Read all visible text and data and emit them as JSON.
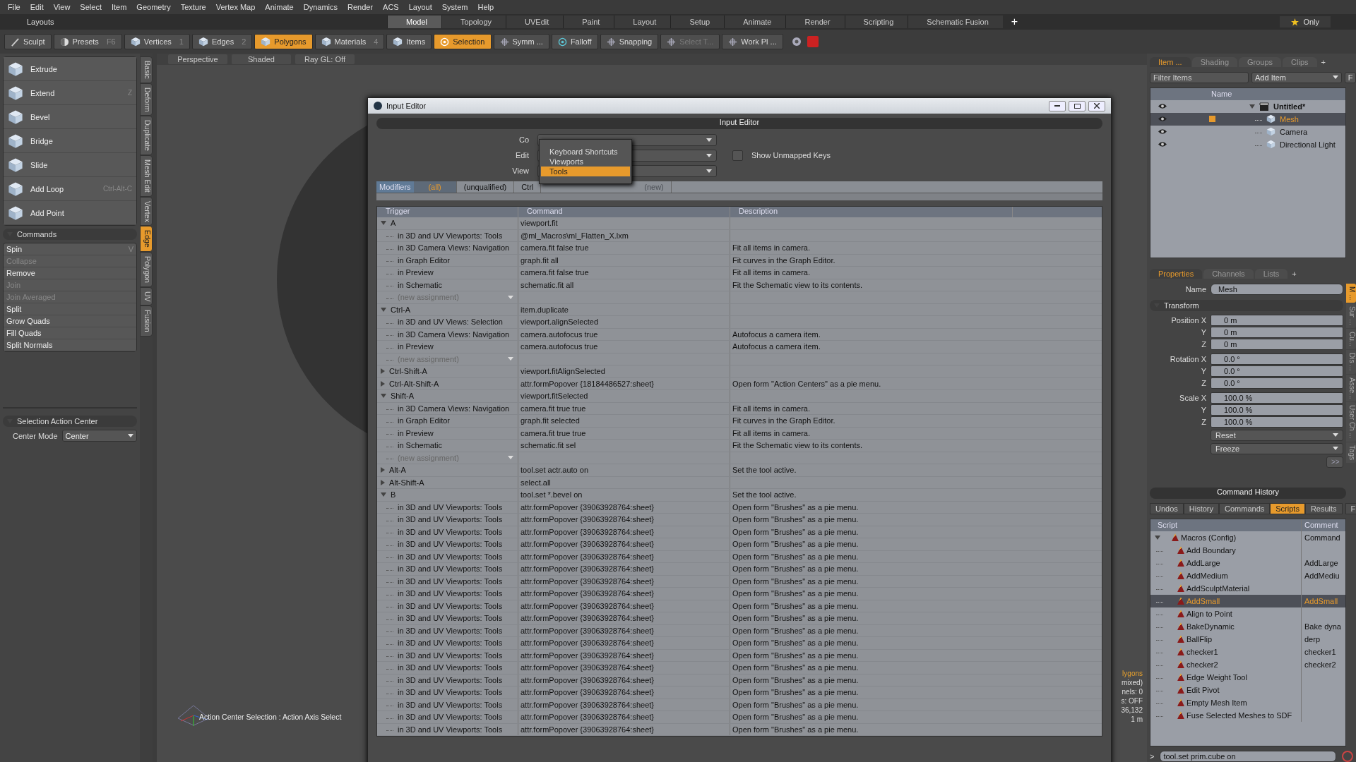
{
  "menu": [
    "File",
    "Edit",
    "View",
    "Select",
    "Item",
    "Geometry",
    "Texture",
    "Vertex Map",
    "Animate",
    "Dynamics",
    "Render",
    "ACS",
    "Layout",
    "System",
    "Help"
  ],
  "layouts": {
    "title": "Layouts",
    "add_label": "+",
    "only_label": "Only",
    "tabs": [
      {
        "label": "Model",
        "selected": true
      },
      {
        "label": "Topology",
        "selected": false
      },
      {
        "label": "UVEdit",
        "selected": false
      },
      {
        "label": "Paint",
        "selected": false
      },
      {
        "label": "Layout",
        "selected": false
      },
      {
        "label": "Setup",
        "selected": false
      },
      {
        "label": "Animate",
        "selected": false
      },
      {
        "label": "Render",
        "selected": false
      },
      {
        "label": "Scripting",
        "selected": false
      },
      {
        "label": "Schematic Fusion",
        "selected": false
      }
    ]
  },
  "toolbar": [
    {
      "label": "Sculpt",
      "selected": false,
      "disabled": false
    },
    {
      "label": "Presets",
      "key": "F6",
      "selected": false,
      "disabled": false
    },
    {
      "label": "Vertices",
      "key": "1",
      "selected": false,
      "disabled": false
    },
    {
      "label": "Edges",
      "key": "2",
      "selected": false,
      "disabled": false
    },
    {
      "label": "Polygons",
      "selected": true,
      "disabled": false
    },
    {
      "label": "Materials",
      "key": "4",
      "selected": false,
      "disabled": false
    },
    {
      "label": "Items",
      "selected": false,
      "disabled": false
    },
    {
      "label": "Selection",
      "selected": true,
      "disabled": false
    },
    {
      "label": "Symm ...",
      "selected": false,
      "disabled": false
    },
    {
      "label": "Falloff",
      "selected": false,
      "disabled": false
    },
    {
      "label": "Snapping",
      "selected": false,
      "disabled": false
    },
    {
      "label": "Select T...",
      "selected": false,
      "disabled": true
    },
    {
      "label": "Work Pl ...",
      "selected": false,
      "disabled": false
    }
  ],
  "left": {
    "tools": [
      {
        "label": "Extrude"
      },
      {
        "label": "Extend",
        "shortcut": "Z"
      },
      {
        "label": "Bevel"
      },
      {
        "label": "Bridge"
      },
      {
        "label": "Slide"
      },
      {
        "label": "Add Loop",
        "shortcut": "Ctrl-Alt-C"
      },
      {
        "label": "Add Point"
      }
    ],
    "commands_title": "Commands",
    "commands": [
      {
        "label": "Spin",
        "shortcut": "V",
        "disabled": false
      },
      {
        "label": "Collapse",
        "disabled": true
      },
      {
        "label": "Remove",
        "disabled": false
      },
      {
        "label": "Join",
        "disabled": true
      },
      {
        "label": "Join Averaged",
        "disabled": true
      },
      {
        "label": "Split",
        "disabled": false
      },
      {
        "label": "Grow Quads",
        "disabled": false
      },
      {
        "label": "Fill Quads",
        "disabled": false
      },
      {
        "label": "Split Normals",
        "disabled": false
      }
    ],
    "side_tabs": [
      {
        "label": "Basic",
        "selected": false
      },
      {
        "label": "Deform",
        "selected": false
      },
      {
        "label": "Duplicate",
        "selected": false
      },
      {
        "label": "Mesh Edit",
        "selected": false
      },
      {
        "label": "Vertex",
        "selected": false
      },
      {
        "label": "Edge",
        "selected": true
      },
      {
        "label": "Polygon",
        "selected": false
      },
      {
        "label": "UV",
        "selected": false
      },
      {
        "label": "Fusion",
        "selected": false
      }
    ],
    "action_center": {
      "title": "Selection Action Center",
      "field_label": "Center Mode",
      "value": "Center"
    }
  },
  "viewport": {
    "tabs": [
      "Perspective",
      "Shaded",
      "Ray GL: Off"
    ],
    "status": "Action Center Selection : Action Axis Select",
    "readout": [
      "lygons",
      "mixed)",
      "nels: 0",
      "s: OFF",
      "36,132",
      "1 m"
    ]
  },
  "dialog": {
    "title": "Input Editor",
    "header": "Input Editor",
    "fields": [
      {
        "label": "Co"
      },
      {
        "label": "Edit"
      },
      {
        "label": "View"
      }
    ],
    "show_unmapped": {
      "label": "Show Unmapped Keys",
      "checked": false
    },
    "popup": [
      {
        "label": "Keyboard Shortcuts",
        "selected": false
      },
      {
        "label": "Viewports",
        "selected": false
      },
      {
        "label": "Tools",
        "selected": true
      }
    ],
    "modifiers_label": "Modifiers",
    "modifiers": [
      {
        "label": "(all)",
        "selected": true,
        "disabled": false
      },
      {
        "label": "(unqualified)",
        "selected": false,
        "disabled": false
      },
      {
        "label": "Ctrl",
        "selected": false,
        "disabled": false
      },
      {
        "label": "(new)",
        "selected": false,
        "disabled": true
      }
    ],
    "columns": [
      "Trigger",
      "Command",
      "Description"
    ],
    "rows": [
      {
        "trigger": "A",
        "command": "viewport.fit",
        "expanded": true,
        "children": [
          {
            "kind": "assignment",
            "trigger": "in 3D and UV Viewports: Tools",
            "command": "@ml_Macros\\ml_Flatten_X.lxm"
          },
          {
            "kind": "assignment",
            "trigger": "in 3D Camera Views: Navigation",
            "command": "camera.fit false true",
            "description": "Fit all items in camera."
          },
          {
            "kind": "assignment",
            "trigger": "in Graph Editor",
            "command": "graph.fit all",
            "description": "Fit curves in the Graph Editor."
          },
          {
            "kind": "assignment",
            "trigger": "in Preview",
            "command": "camera.fit false true",
            "description": "Fit all items in camera."
          },
          {
            "kind": "assignment",
            "trigger": "in Schematic",
            "command": "schematic.fit all",
            "description": "Fit the Schematic view to its contents."
          },
          {
            "kind": "new",
            "trigger": "(new assignment)"
          }
        ]
      },
      {
        "trigger": "Ctrl-A",
        "command": "item.duplicate",
        "expanded": true,
        "children": [
          {
            "kind": "assignment",
            "trigger": "in 3D and UV Views: Selection",
            "command": "viewport.alignSelected"
          },
          {
            "kind": "assignment",
            "trigger": "in 3D Camera Views: Navigation",
            "command": "camera.autofocus true",
            "description": "Autofocus a camera item."
          },
          {
            "kind": "assignment",
            "trigger": "in Preview",
            "command": "camera.autofocus true",
            "description": "Autofocus a camera item."
          },
          {
            "kind": "new",
            "trigger": "(new assignment)"
          }
        ]
      },
      {
        "trigger": "Ctrl-Shift-A",
        "command": "viewport.fitAlignSelected",
        "expanded": false
      },
      {
        "trigger": "Ctrl-Alt-Shift-A",
        "command": "attr.formPopover {18184486527:sheet}",
        "description": "Open form \"Action Centers\" as a pie menu.",
        "expanded": false
      },
      {
        "trigger": "Shift-A",
        "command": "viewport.fitSelected",
        "expanded": true,
        "children": [
          {
            "kind": "assignment",
            "trigger": "in 3D Camera Views: Navigation",
            "command": "camera.fit true true",
            "description": "Fit all items in camera."
          },
          {
            "kind": "assignment",
            "trigger": "in Graph Editor",
            "command": "graph.fit selected",
            "description": "Fit curves in the Graph Editor."
          },
          {
            "kind": "assignment",
            "trigger": "in Preview",
            "command": "camera.fit true true",
            "description": "Fit all items in camera."
          },
          {
            "kind": "assignment",
            "trigger": "in Schematic",
            "command": "schematic.fit sel",
            "description": "Fit the Schematic view to its contents."
          },
          {
            "kind": "new",
            "trigger": "(new assignment)"
          }
        ]
      },
      {
        "trigger": "Alt-A",
        "command": "tool.set actr.auto on",
        "description": "Set the tool active.",
        "expanded": false
      },
      {
        "trigger": "Alt-Shift-A",
        "command": "select.all",
        "expanded": false
      },
      {
        "trigger": "B",
        "command": "tool.set *.bevel on",
        "description": "Set the tool active.",
        "expanded": true,
        "children": [
          {
            "kind": "assignment",
            "trigger": "in 3D and UV Viewports: Tools",
            "command": "attr.formPopover {39063928764:sheet}",
            "description": "Open form \"Brushes\" as a pie menu."
          },
          {
            "kind": "assignment",
            "trigger": "in 3D and UV Viewports: Tools",
            "command": "attr.formPopover {39063928764:sheet}",
            "description": "Open form \"Brushes\" as a pie menu."
          },
          {
            "kind": "assignment",
            "trigger": "in 3D and UV Viewports: Tools",
            "command": "attr.formPopover {39063928764:sheet}",
            "description": "Open form \"Brushes\" as a pie menu."
          },
          {
            "kind": "assignment",
            "trigger": "in 3D and UV Viewports: Tools",
            "command": "attr.formPopover {39063928764:sheet}",
            "description": "Open form \"Brushes\" as a pie menu."
          },
          {
            "kind": "assignment",
            "trigger": "in 3D and UV Viewports: Tools",
            "command": "attr.formPopover {39063928764:sheet}",
            "description": "Open form \"Brushes\" as a pie menu."
          },
          {
            "kind": "assignment",
            "trigger": "in 3D and UV Viewports: Tools",
            "command": "attr.formPopover {39063928764:sheet}",
            "description": "Open form \"Brushes\" as a pie menu."
          },
          {
            "kind": "assignment",
            "trigger": "in 3D and UV Viewports: Tools",
            "command": "attr.formPopover {39063928764:sheet}",
            "description": "Open form \"Brushes\" as a pie menu."
          },
          {
            "kind": "assignment",
            "trigger": "in 3D and UV Viewports: Tools",
            "command": "attr.formPopover {39063928764:sheet}",
            "description": "Open form \"Brushes\" as a pie menu."
          },
          {
            "kind": "assignment",
            "trigger": "in 3D and UV Viewports: Tools",
            "command": "attr.formPopover {39063928764:sheet}",
            "description": "Open form \"Brushes\" as a pie menu."
          },
          {
            "kind": "assignment",
            "trigger": "in 3D and UV Viewports: Tools",
            "command": "attr.formPopover {39063928764:sheet}",
            "description": "Open form \"Brushes\" as a pie menu."
          },
          {
            "kind": "assignment",
            "trigger": "in 3D and UV Viewports: Tools",
            "command": "attr.formPopover {39063928764:sheet}",
            "description": "Open form \"Brushes\" as a pie menu."
          },
          {
            "kind": "assignment",
            "trigger": "in 3D and UV Viewports: Tools",
            "command": "attr.formPopover {39063928764:sheet}",
            "description": "Open form \"Brushes\" as a pie menu."
          },
          {
            "kind": "assignment",
            "trigger": "in 3D and UV Viewports: Tools",
            "command": "attr.formPopover {39063928764:sheet}",
            "description": "Open form \"Brushes\" as a pie menu."
          },
          {
            "kind": "assignment",
            "trigger": "in 3D and UV Viewports: Tools",
            "command": "attr.formPopover {39063928764:sheet}",
            "description": "Open form \"Brushes\" as a pie menu."
          },
          {
            "kind": "assignment",
            "trigger": "in 3D and UV Viewports: Tools",
            "command": "attr.formPopover {39063928764:sheet}",
            "description": "Open form \"Brushes\" as a pie menu."
          },
          {
            "kind": "assignment",
            "trigger": "in 3D and UV Viewports: Tools",
            "command": "attr.formPopover {39063928764:sheet}",
            "description": "Open form \"Brushes\" as a pie menu."
          },
          {
            "kind": "assignment",
            "trigger": "in 3D and UV Viewports: Tools",
            "command": "attr.formPopover {39063928764:sheet}",
            "description": "Open form \"Brushes\" as a pie menu."
          },
          {
            "kind": "assignment",
            "trigger": "in 3D and UV Viewports: Tools",
            "command": "attr.formPopover {39063928764:sheet}",
            "description": "Open form \"Brushes\" as a pie menu."
          },
          {
            "kind": "assignment",
            "trigger": "in 3D and UV Viewports: Tools",
            "command": "attr.formPopover {39063928764:sheet}",
            "description": "Open form \"Brushes\" as a pie menu."
          }
        ]
      }
    ]
  },
  "right": {
    "item_tabs": [
      {
        "label": "Item ...",
        "selected": true
      },
      {
        "label": "Shading",
        "selected": false
      },
      {
        "label": "Groups",
        "selected": false
      },
      {
        "label": "Clips",
        "selected": false
      }
    ],
    "add_tab": "+",
    "filter_placeholder": "Filter Items",
    "add_item": "Add Item",
    "f_button": "F",
    "name_column": "Name",
    "items": [
      {
        "name": "Untitled*",
        "selected": false,
        "expanded": true,
        "children": [
          {
            "name": "Mesh",
            "selected": true
          },
          {
            "name": "Camera",
            "selected": false
          },
          {
            "name": "Directional Light",
            "selected": false
          }
        ]
      }
    ],
    "prop_tabs": [
      {
        "label": "Properties",
        "selected": true
      },
      {
        "label": "Channels",
        "selected": false
      },
      {
        "label": "Lists",
        "selected": false
      }
    ],
    "name_label": "Name",
    "name_value": "Mesh",
    "transform_title": "Transform",
    "transform": [
      [
        {
          "label": "Position X",
          "value": "0 m"
        },
        {
          "label": "Y",
          "value": "0 m"
        },
        {
          "label": "Z",
          "value": "0 m"
        }
      ],
      [
        {
          "label": "Rotation X",
          "value": "0.0 °"
        },
        {
          "label": "Y",
          "value": "0.0 °"
        },
        {
          "label": "Z",
          "value": "0.0 °"
        }
      ],
      [
        {
          "label": "Scale X",
          "value": "100.0 %"
        },
        {
          "label": "Y",
          "value": "100.0 %"
        },
        {
          "label": "Z",
          "value": "100.0 %"
        }
      ]
    ],
    "actions": [
      "Reset",
      "Freeze"
    ],
    "more_button": ">>",
    "side_tabs": [
      {
        "label": "M ...",
        "selected": true
      },
      {
        "label": "Sur ...",
        "selected": false
      },
      {
        "label": "Cu...",
        "selected": false
      },
      {
        "label": "Dis ...",
        "selected": false
      },
      {
        "label": "Asse...",
        "selected": false
      },
      {
        "label": "User Ch ...",
        "selected": false
      },
      {
        "label": "Tags",
        "selected": false
      }
    ],
    "history": {
      "title": "Command History",
      "tabs": [
        {
          "label": "Undos",
          "selected": false
        },
        {
          "label": "History",
          "selected": false
        },
        {
          "label": "Commands",
          "selected": false
        },
        {
          "label": "Scripts",
          "selected": true
        },
        {
          "label": "Results",
          "selected": false
        }
      ],
      "f_button": "F",
      "columns": [
        "Script",
        "Comment"
      ],
      "scripts": [
        {
          "name": "Macros (Config)",
          "comment": "Command",
          "selected": false,
          "expanded": true,
          "children": [
            {
              "name": "Add Boundary",
              "selected": false
            },
            {
              "name": "AddLarge",
              "comment": "AddLarge",
              "selected": false
            },
            {
              "name": "AddMedium",
              "comment": "AddMediu",
              "selected": false
            },
            {
              "name": "AddSculptMaterial",
              "selected": false
            },
            {
              "name": "AddSmall",
              "comment": "AddSmall",
              "selected": true
            },
            {
              "name": "Align to Point",
              "selected": false
            },
            {
              "name": "BakeDynamic",
              "comment": "Bake dyna",
              "selected": false
            },
            {
              "name": "BallFlip",
              "comment": "derp",
              "selected": false
            },
            {
              "name": "checker1",
              "comment": "checker1",
              "selected": false
            },
            {
              "name": "checker2",
              "comment": "checker2",
              "selected": false
            },
            {
              "name": "Edge Weight Tool",
              "selected": false
            },
            {
              "name": "Edit Pivot",
              "selected": false
            },
            {
              "name": "Empty Mesh Item",
              "selected": false
            },
            {
              "name": "Fuse Selected Meshes to SDF",
              "selected": false
            }
          ]
        }
      ],
      "prompt": ">",
      "command": "tool.set prim.cube on"
    }
  }
}
